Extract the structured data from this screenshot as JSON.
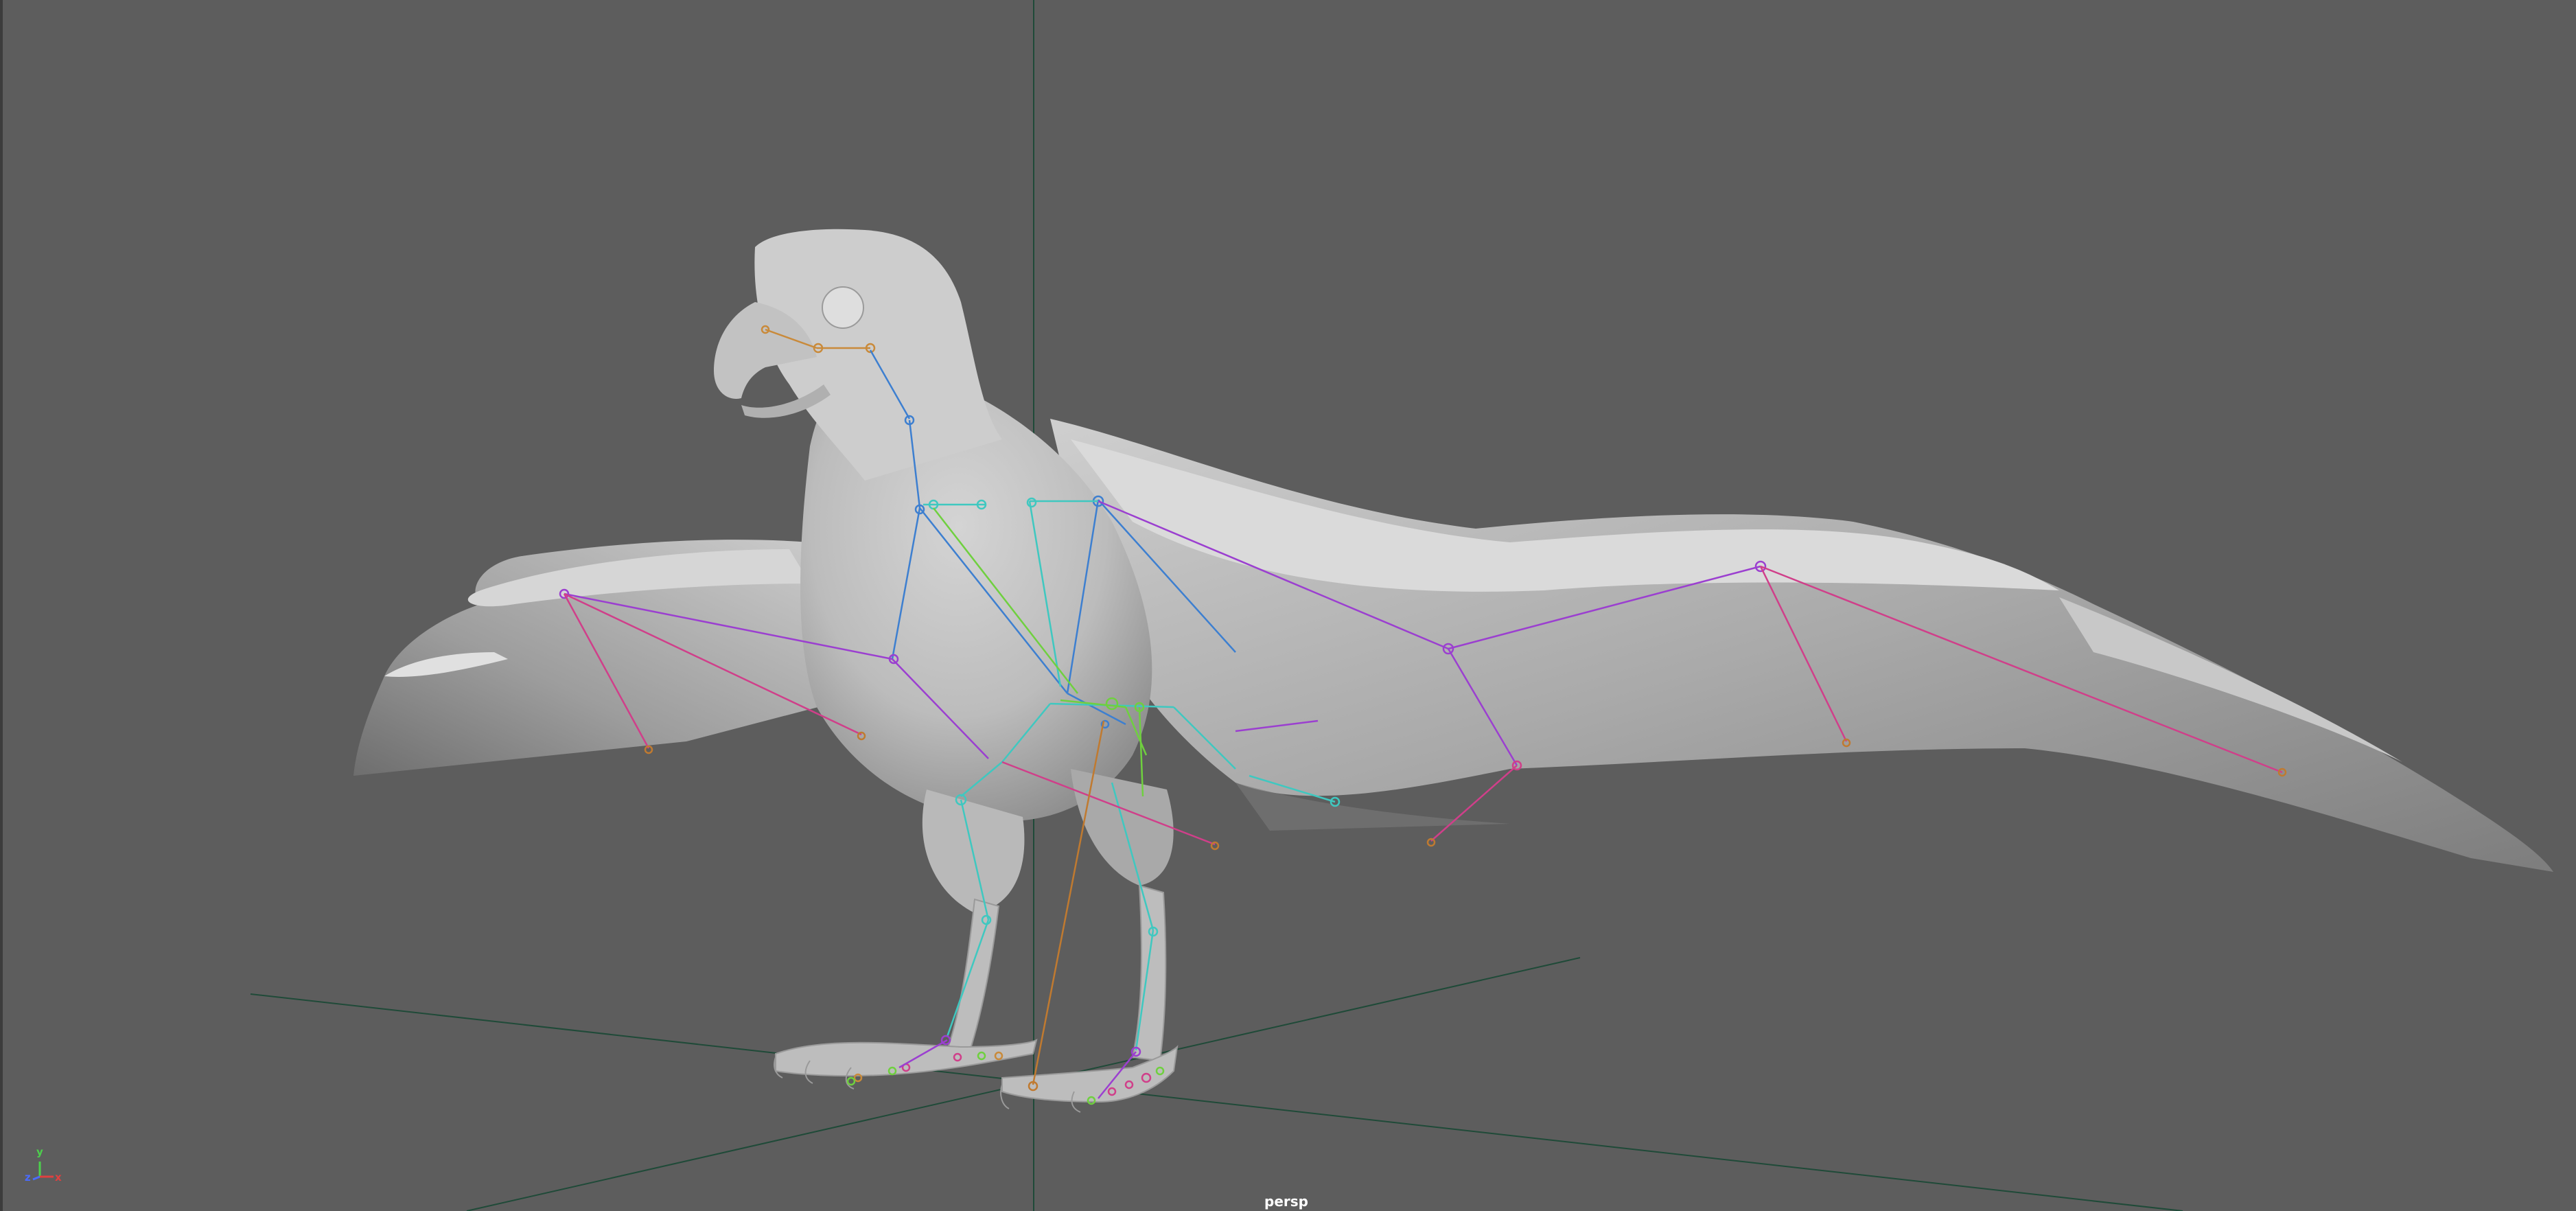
{
  "viewport": {
    "camera_label": "persp",
    "background_color": "#5d5d5d",
    "grid_color": "#1f4a38",
    "mesh_color": "#c8c8c8"
  },
  "axis_gizmo": {
    "y_label": "y",
    "z_label": "z",
    "x_label": "x",
    "y_color": "#4cd14c",
    "z_color": "#4a6cff",
    "x_color": "#e04040"
  },
  "skeleton": {
    "colors": {
      "head": "#c98a3a",
      "spine": "#3d7fd0",
      "neck": "#3fc8c0",
      "wing": "#9b3fd0",
      "wing_tip": "#d03f8a",
      "tail": "#6fd03f",
      "leg": "#3fc8c0",
      "pole": "#c07a30"
    }
  }
}
